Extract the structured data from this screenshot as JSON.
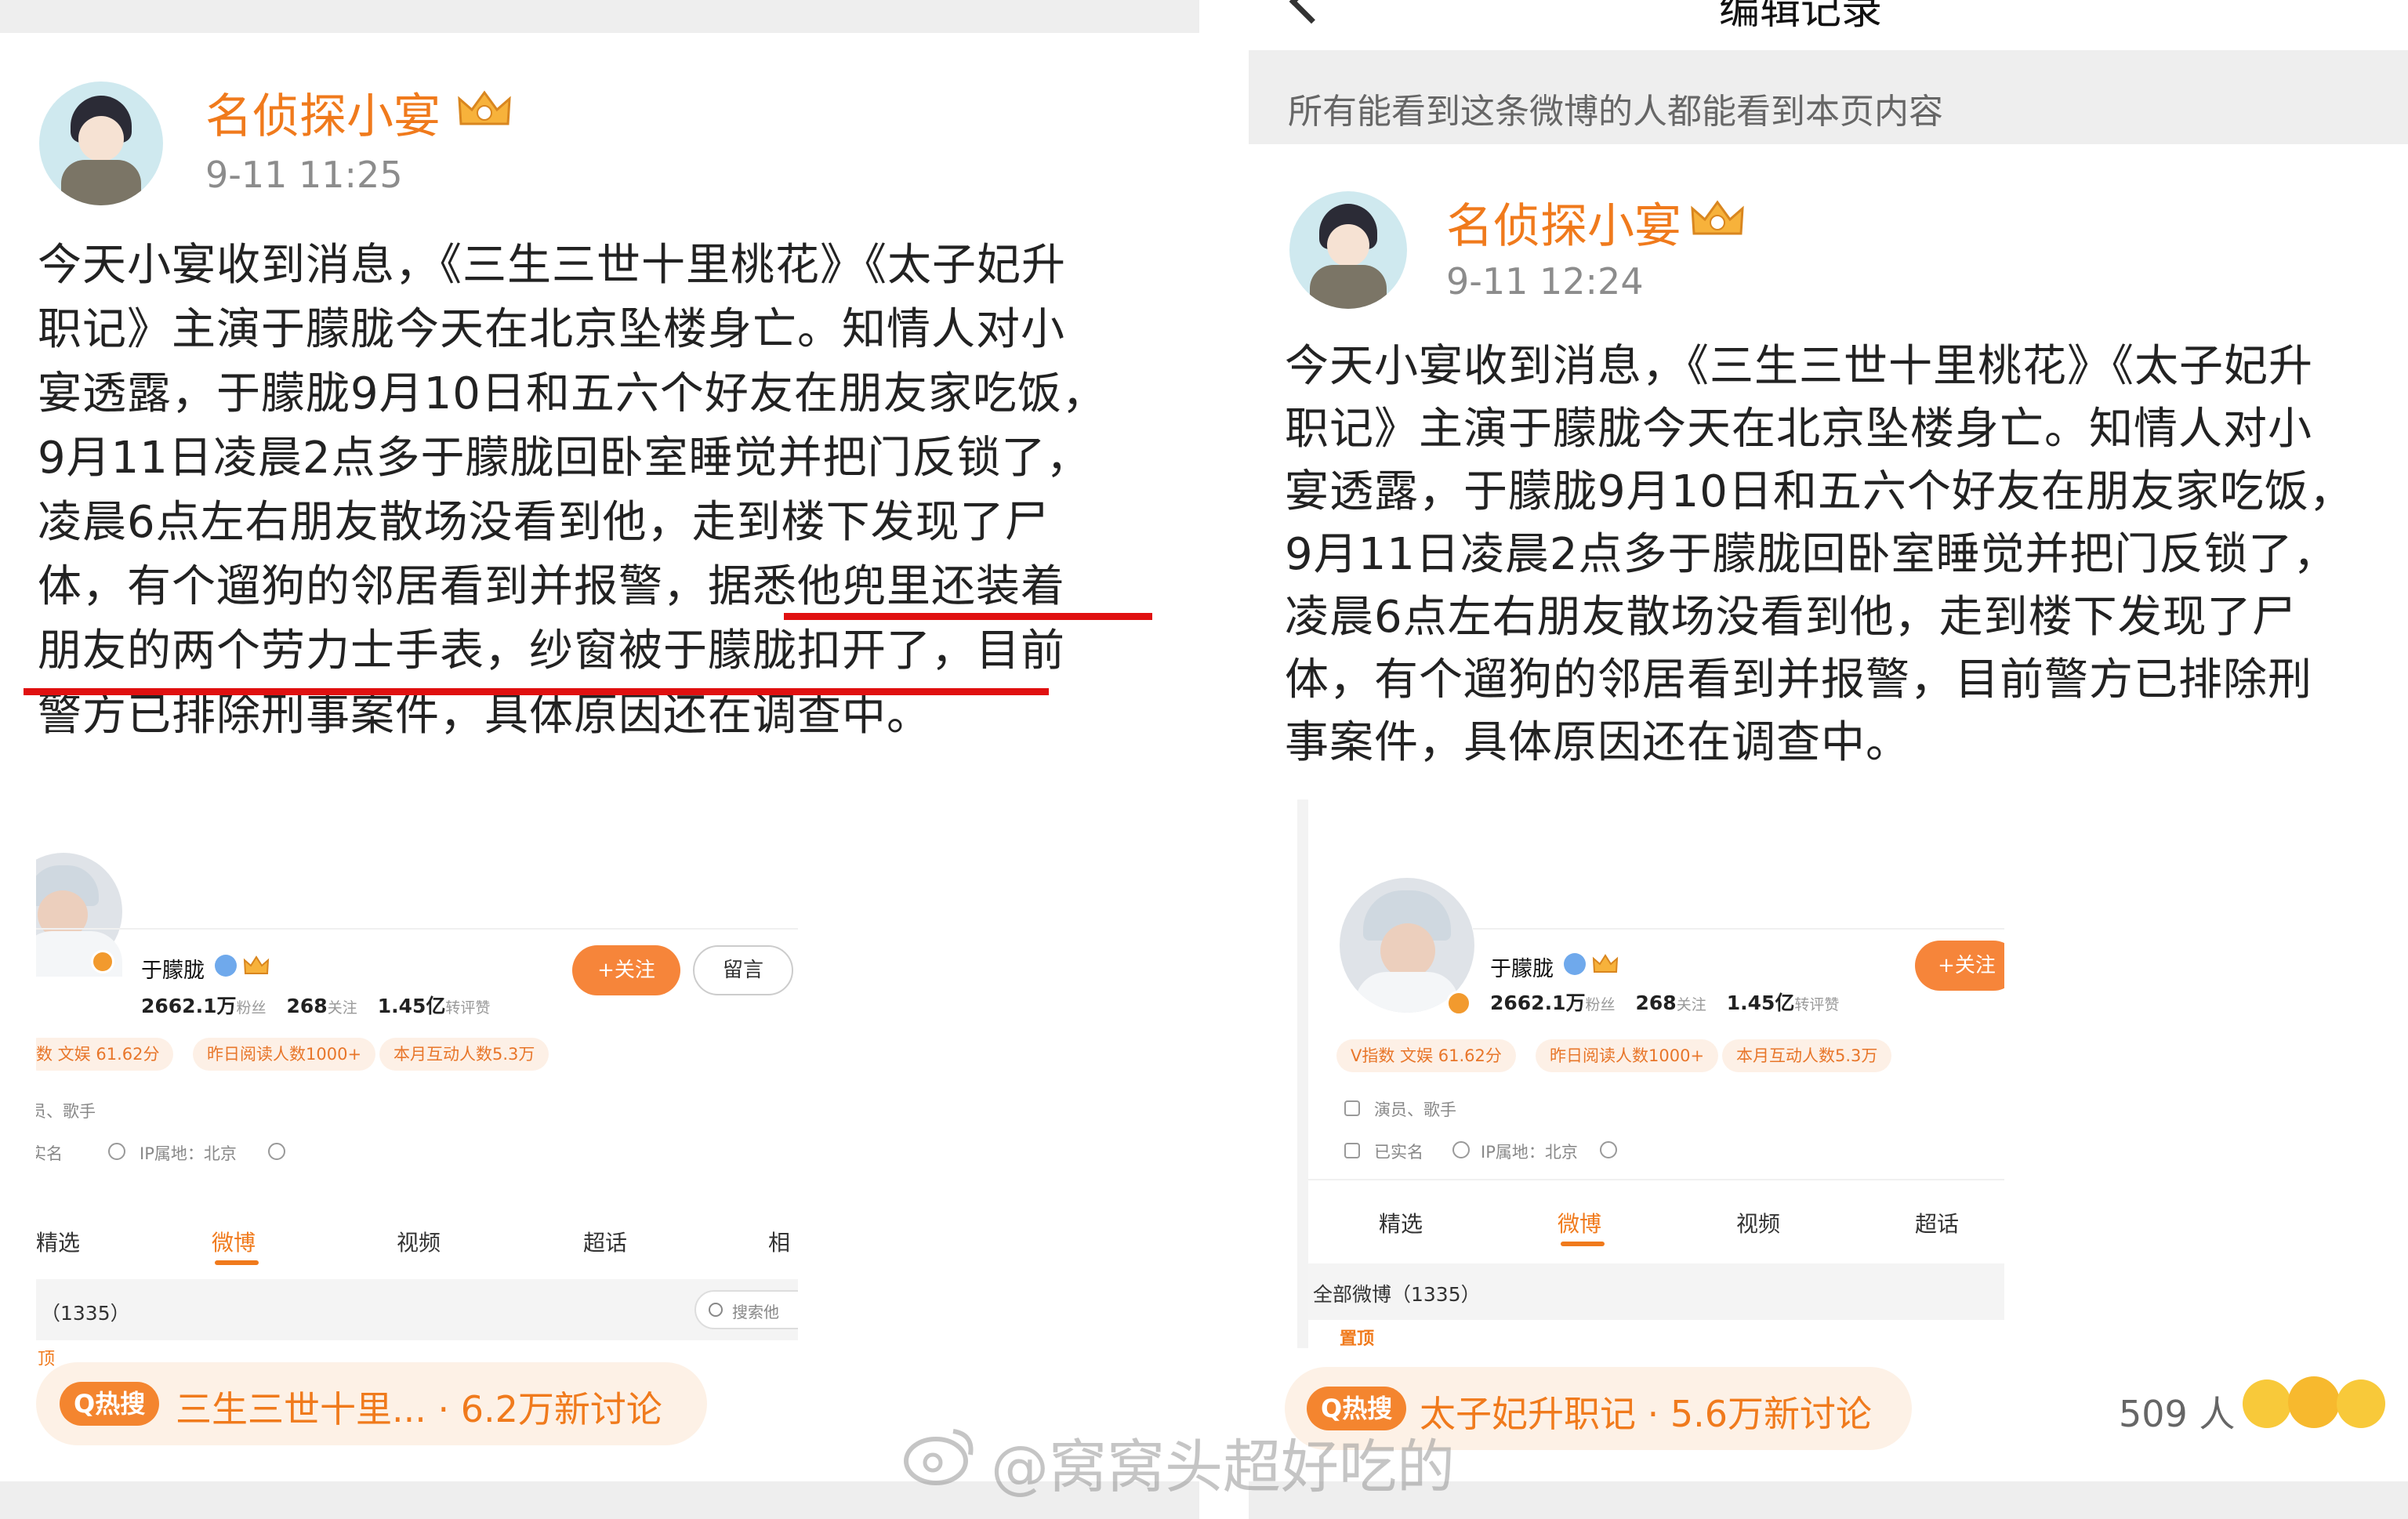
{
  "left": {
    "poster_name": "名侦探小宴",
    "time": "9-11 11:25",
    "text_lines": [
      "今天小宴收到消息，《三生三世十里桃花》《太子妃升",
      "职记》主演于朦胧今天在北京坠楼身亡。知情人对小",
      "宴透露，于朦胧9月10日和五六个好友在朋友家吃饭，",
      "9月11日凌晨2点多于朦胧回卧室睡觉并把门反锁了，",
      "凌晨6点左右朋友散场没看到他，走到楼下发现了尸",
      "体，有个遛狗的邻居看到并报警，据悉他兜里还装着",
      "朋友的两个劳力士手表，纱窗被于朦胧扣开了，目前",
      "警方已排除刑事案件，具体原因还在调查中。"
    ],
    "profile": {
      "name": "于朦胧",
      "followers": "2662.1万",
      "followers_label": "粉丝",
      "following": "268",
      "following_label": "关注",
      "likes": "1.45亿",
      "likes_label": "转评赞",
      "pills": [
        "数 文娱 61.62分",
        "昨日阅读人数1000+",
        "本月互动人数5.3万"
      ],
      "role": "员、歌手",
      "realname": "实名",
      "ip": "IP属地：北京",
      "follow_btn": "+关注",
      "msg_btn": "留言",
      "tabs": [
        "精选",
        "微博",
        "视频",
        "超话",
        "相"
      ],
      "filter": "（1335）",
      "search": "搜索他",
      "pin": "顶"
    },
    "hot_badge": "Q热搜",
    "hot_text": "三生三世十里... · 6.2万新讨论"
  },
  "right": {
    "header_title": "编辑记录",
    "notice": "所有能看到这条微博的人都能看到本页内容",
    "poster_name": "名侦探小宴",
    "time": "9-11 12:24",
    "text_lines": [
      "今天小宴收到消息，《三生三世十里桃花》《太子妃升",
      "职记》主演于朦胧今天在北京坠楼身亡。知情人对小",
      "宴透露，于朦胧9月10日和五六个好友在朋友家吃饭，",
      "9月11日凌晨2点多于朦胧回卧室睡觉并把门反锁了，",
      "凌晨6点左右朋友散场没看到他，走到楼下发现了尸",
      "体，有个遛狗的邻居看到并报警，目前警方已排除刑",
      "事案件，具体原因还在调查中。"
    ],
    "profile": {
      "name": "于朦胧",
      "followers": "2662.1万",
      "followers_label": "粉丝",
      "following": "268",
      "following_label": "关注",
      "likes": "1.45亿",
      "likes_label": "转评赞",
      "pills": [
        "V指数 文娱 61.62分",
        "昨日阅读人数1000+",
        "本月互动人数5.3万"
      ],
      "role": "演员、歌手",
      "realname": "已实名",
      "ip": "IP属地：北京",
      "follow_btn": "+关注",
      "tabs": [
        "精选",
        "微博",
        "视频",
        "超话"
      ],
      "filter": "全部微博（1335）",
      "pin": "置顶"
    },
    "hot_badge": "Q热搜",
    "hot_text": "太子妃升职记 · 5.6万新讨论",
    "likes_count": "509 人"
  },
  "watermark": "@窝窝头超好吃的",
  "colors": {
    "accent": "#f07a1c",
    "underline": "#e01010"
  }
}
